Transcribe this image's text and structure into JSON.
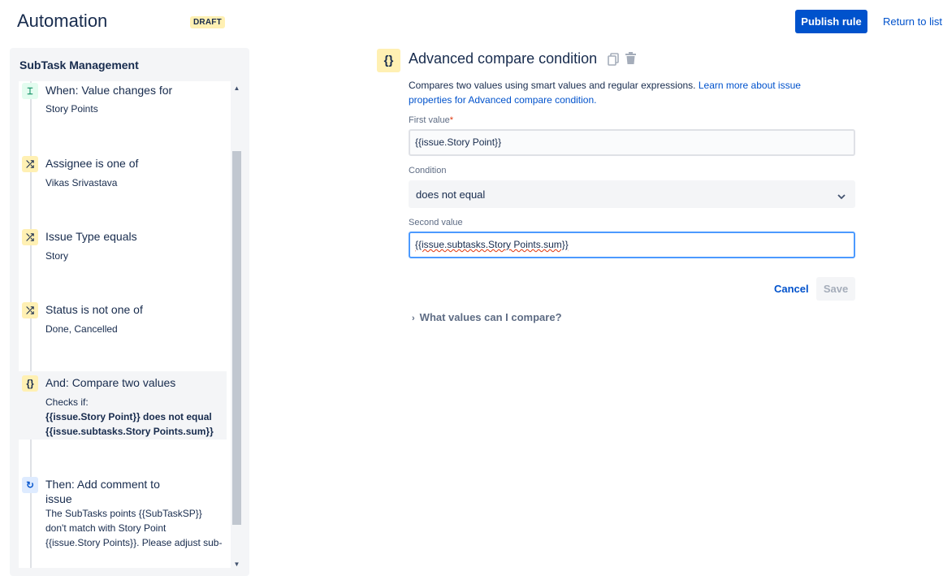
{
  "header": {
    "title": "Automation",
    "status_badge": "DRAFT",
    "publish_label": "Publish rule",
    "return_label": "Return to list"
  },
  "sidebar": {
    "title": "SubTask Management",
    "components": [
      {
        "icon": "trigger-icon",
        "title": "When: Value changes for",
        "lines": [
          "Story Points"
        ]
      },
      {
        "icon": "branch-condition-icon",
        "title": "Assignee is one of",
        "lines": [
          "Vikas Srivastava"
        ]
      },
      {
        "icon": "branch-condition-icon",
        "title": "Issue Type equals",
        "lines": [
          "Story"
        ]
      },
      {
        "icon": "branch-condition-icon",
        "title": "Status is not one of",
        "lines": [
          "Done, Cancelled"
        ]
      },
      {
        "icon": "curly-braces-icon",
        "title": "And: Compare two values",
        "lines": [
          "Checks if:",
          "{{issue.Story Point}} does not equal",
          "{{issue.subtasks.Story Points.sum}}"
        ]
      },
      {
        "icon": "refresh-action-icon",
        "title": "Then: Add comment to",
        "title2": "issue",
        "lines": [
          "The SubTasks points {{SubTaskSP}}",
          "don't match with Story Point",
          "{{issue.Story Points}}. Please adjust sub-"
        ]
      }
    ]
  },
  "editor": {
    "icon": "{}",
    "title": "Advanced compare condition",
    "description": "Compares two values using smart values and regular expressions.",
    "link_text": "Learn more about issue properties for Advanced compare condition.",
    "first_value_label": "First value",
    "required_marker": "*",
    "first_value": "{{issue.Story Point}}",
    "condition_label": "Condition",
    "condition_value": "does not equal",
    "second_value_label": "Second value",
    "second_value": "{{issue.subtasks.Story Points.sum}}",
    "cancel_label": "Cancel",
    "save_label": "Save",
    "expand_label": "What values can I compare?"
  }
}
